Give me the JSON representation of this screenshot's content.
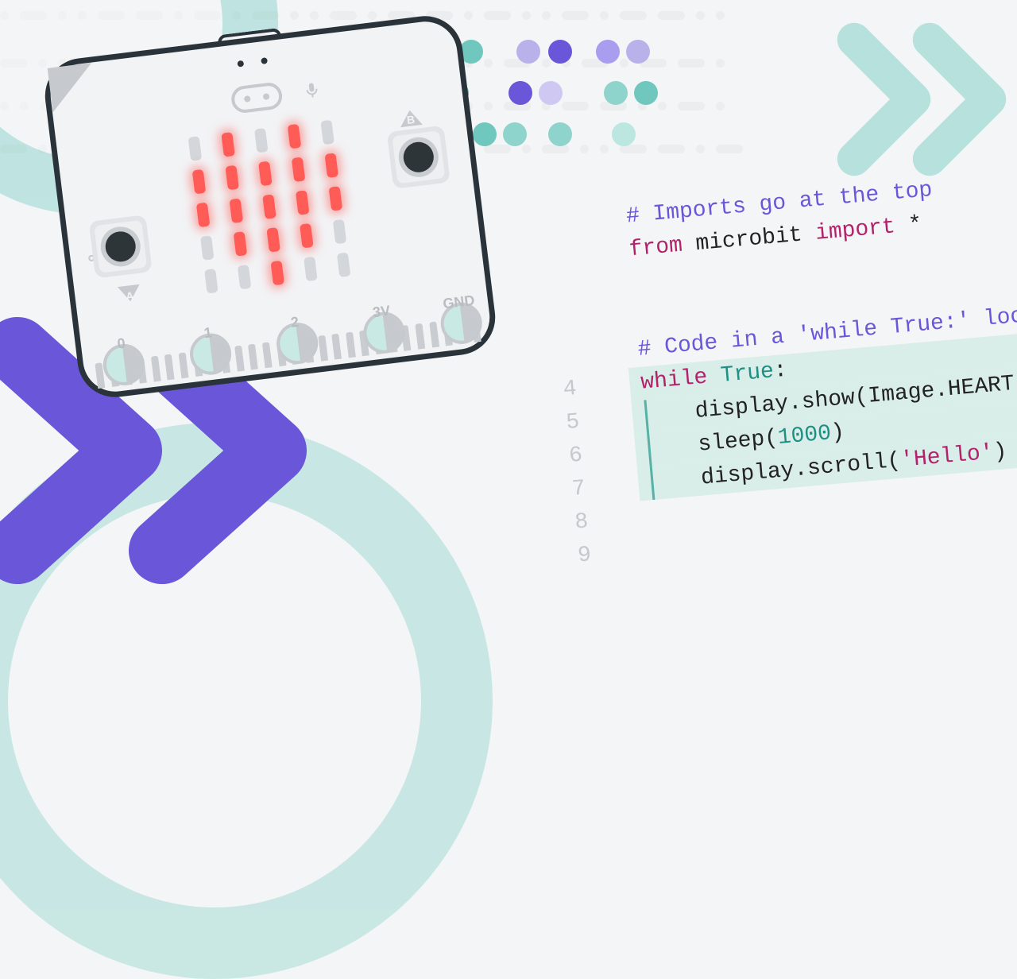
{
  "board": {
    "button_a_label": "A",
    "button_b_label": "B",
    "pins": [
      "0",
      "1",
      "2",
      "3V",
      "GND"
    ],
    "led_heart_pattern": [
      [
        0,
        1,
        0,
        1,
        0
      ],
      [
        1,
        1,
        1,
        1,
        1
      ],
      [
        1,
        1,
        1,
        1,
        1
      ],
      [
        0,
        1,
        1,
        1,
        0
      ],
      [
        0,
        0,
        1,
        0,
        0
      ]
    ]
  },
  "gutter_lines": [
    "4",
    "5",
    "6",
    "7",
    "8",
    "9"
  ],
  "code": {
    "l1_comment": "# Imports go at the top",
    "l2_from": "from",
    "l2_mod": " microbit ",
    "l2_import": "import",
    "l2_star": " *",
    "l4_comment": "# Code in a 'while True:' loop",
    "l5_while": "while",
    "l5_true": " True",
    "l5_colon": ":",
    "l6": "display.show(Image.HEART)",
    "l7a": "sleep(",
    "l7num": "1000",
    "l7b": ")",
    "l8a": "display.scroll(",
    "l8str": "'Hello'",
    "l8b": ")"
  },
  "colors": {
    "purple": "#6a56d8",
    "magenta": "#b3216a",
    "teal": "#1e8f84",
    "teal_light": "#6fc7bd",
    "hl_bg": "#d9ede9"
  }
}
